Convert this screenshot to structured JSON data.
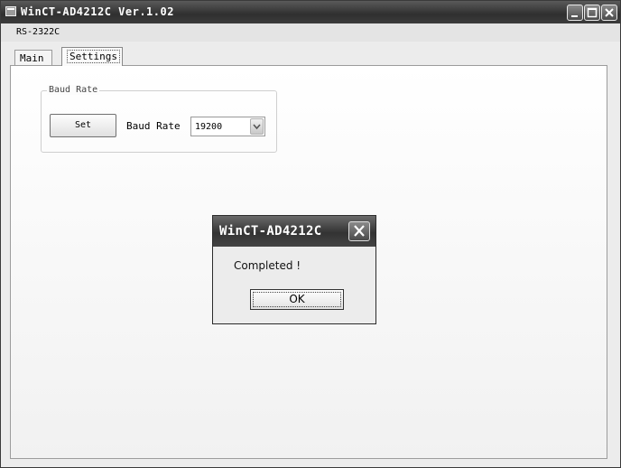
{
  "window": {
    "title": "WinCT-AD4212C Ver.1.02",
    "icons": [
      "app-icon",
      "minimize-icon",
      "maximize-icon",
      "close-icon"
    ]
  },
  "menubar": {
    "item": "RS-2322C"
  },
  "tabs": [
    {
      "label": "Main"
    },
    {
      "label": "Settings",
      "selected": true
    }
  ],
  "baud_group": {
    "legend": "Baud Rate",
    "set_label": "Set",
    "baud_label": "Baud Rate",
    "baud_value": "19200"
  },
  "dialog": {
    "title": "WinCT-AD4212C",
    "message": "Completed !",
    "ok_label": "OK"
  }
}
